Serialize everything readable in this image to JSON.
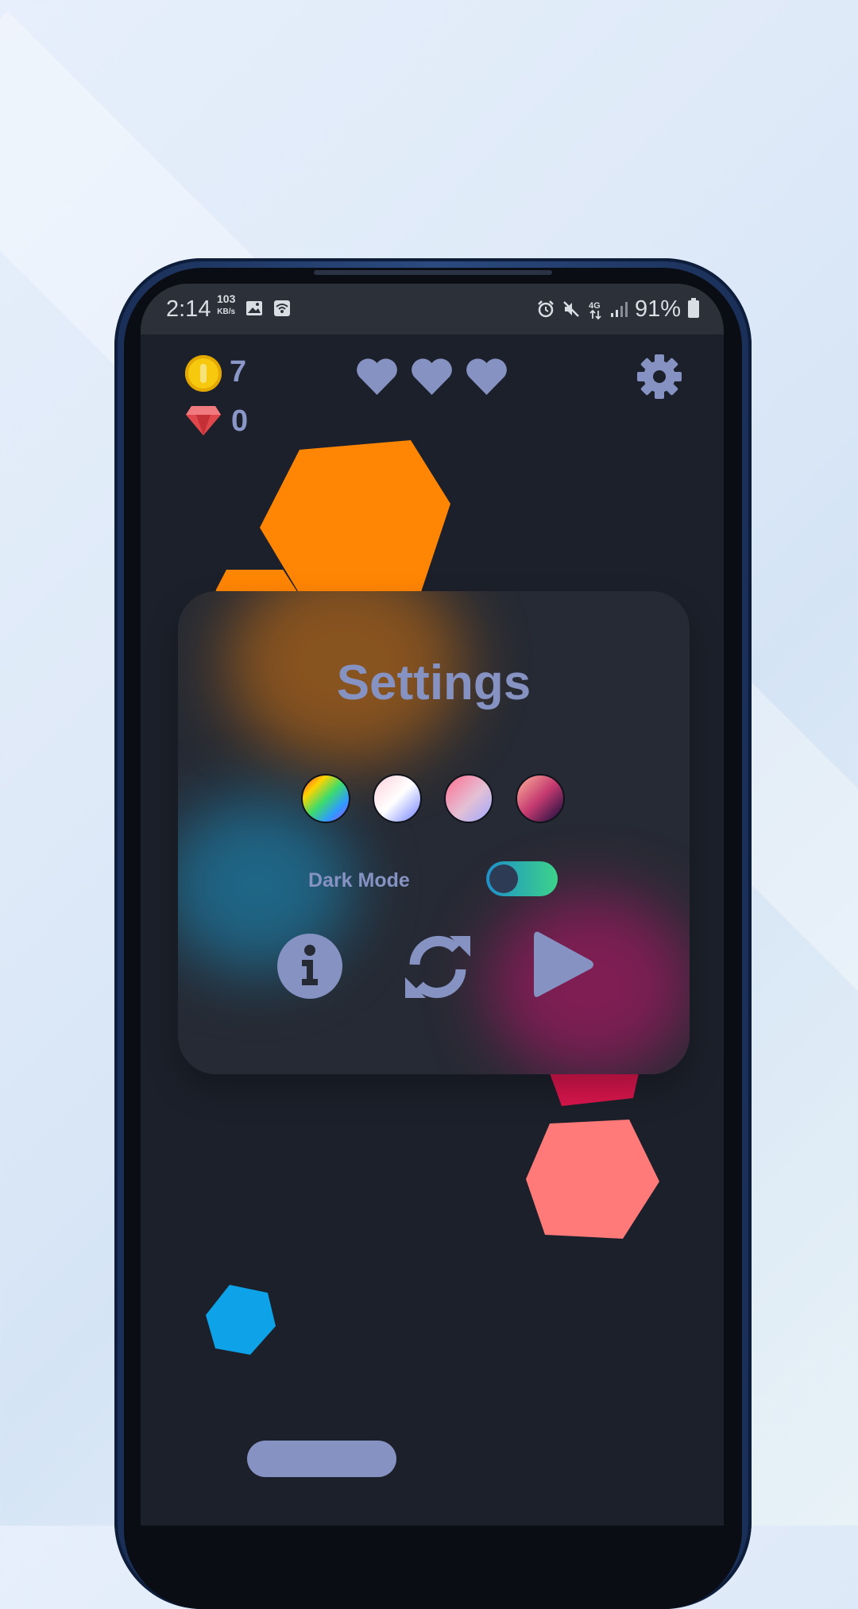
{
  "status_bar": {
    "time": "2:14",
    "net_speed_value": "103",
    "net_speed_unit": "KB/s",
    "battery_percent": "91%"
  },
  "hud": {
    "coins": "7",
    "gems": "0",
    "lives": 3
  },
  "settings_panel": {
    "title": "Settings",
    "themes": [
      "rainbow",
      "pink-blue",
      "pink-lavender",
      "rose-navy"
    ],
    "dark_mode_label": "Dark Mode",
    "dark_mode_enabled": true,
    "buttons": [
      "info-icon",
      "restart-icon",
      "play-icon"
    ]
  },
  "colors": {
    "background": "#1c202a",
    "accent": "#8592c2",
    "orange": "#ff8504",
    "coral": "#ff7a79",
    "blue": "#0ea2e8",
    "crimson": "#d9164d"
  }
}
